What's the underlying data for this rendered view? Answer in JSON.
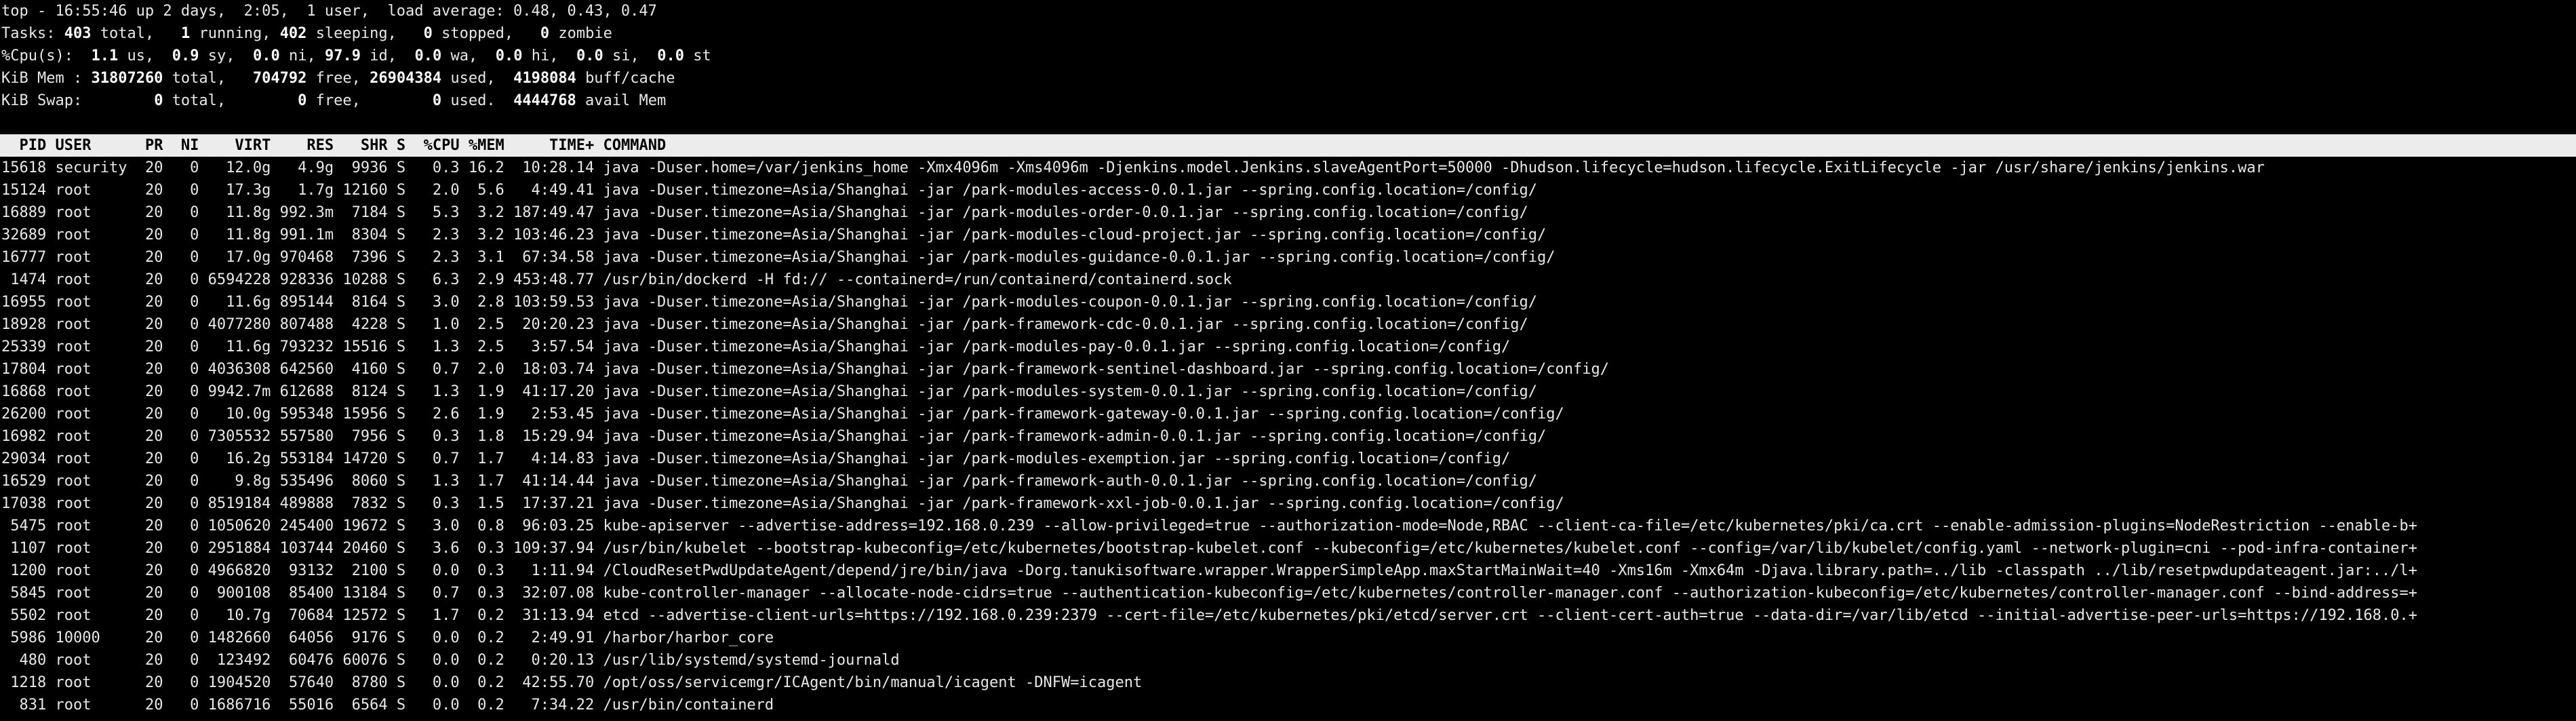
{
  "terminal": {
    "colors": {
      "background": "#000000",
      "foreground": "#e8e8e8",
      "header_bar_background": "#ececec",
      "header_bar_foreground": "#000000"
    },
    "summary": {
      "uptime_line": "top - 16:55:46 up 2 days,  2:05,  1 user,  load average: 0.48, 0.43, 0.47",
      "tasks": {
        "label": "Tasks:",
        "total": "403",
        "total_label": "total,",
        "running": "1",
        "running_label": "running,",
        "sleeping": "402",
        "sleeping_label": "sleeping,",
        "stopped": "0",
        "stopped_label": "stopped,",
        "zombie": "0",
        "zombie_label": "zombie"
      },
      "cpu": {
        "label": "%Cpu(s):",
        "us": "1.1",
        "us_label": "us,",
        "sy": "0.9",
        "sy_label": "sy,",
        "ni": "0.0",
        "ni_label": "ni,",
        "id": "97.9",
        "id_label": "id,",
        "wa": "0.0",
        "wa_label": "wa,",
        "hi": "0.0",
        "hi_label": "hi,",
        "si": "0.0",
        "si_label": "si,",
        "st": "0.0",
        "st_label": "st"
      },
      "mem": {
        "label": "KiB Mem :",
        "total": "31807260",
        "total_label": "total,",
        "free": "704792",
        "free_label": "free,",
        "used": "26904384",
        "used_label": "used,",
        "buff_cache": "4198084",
        "buff_cache_label": "buff/cache"
      },
      "swap": {
        "label": "KiB Swap:",
        "total": "0",
        "total_label": "total,",
        "free": "0",
        "free_label": "free,",
        "used": "0",
        "used_label": "used.",
        "avail": "4444768",
        "avail_label": "avail Mem"
      }
    },
    "columns": [
      "PID",
      "USER",
      "PR",
      "NI",
      "VIRT",
      "RES",
      "SHR",
      "S",
      "%CPU",
      "%MEM",
      "TIME+",
      "COMMAND"
    ],
    "processes": [
      [
        "15618",
        "security",
        "20",
        "0",
        "12.0g",
        "4.9g",
        "9936",
        "S",
        "0.3",
        "16.2",
        "10:28.14",
        "java -Duser.home=/var/jenkins_home -Xmx4096m -Xms4096m -Djenkins.model.Jenkins.slaveAgentPort=50000 -Dhudson.lifecycle=hudson.lifecycle.ExitLifecycle -jar /usr/share/jenkins/jenkins.war"
      ],
      [
        "15124",
        "root",
        "20",
        "0",
        "17.3g",
        "1.7g",
        "12160",
        "S",
        "2.0",
        "5.6",
        "4:49.41",
        "java -Duser.timezone=Asia/Shanghai -jar /park-modules-access-0.0.1.jar --spring.config.location=/config/"
      ],
      [
        "16889",
        "root",
        "20",
        "0",
        "11.8g",
        "992.3m",
        "7184",
        "S",
        "5.3",
        "3.2",
        "187:49.47",
        "java -Duser.timezone=Asia/Shanghai -jar /park-modules-order-0.0.1.jar --spring.config.location=/config/"
      ],
      [
        "32689",
        "root",
        "20",
        "0",
        "11.8g",
        "991.1m",
        "8304",
        "S",
        "2.3",
        "3.2",
        "103:46.23",
        "java -Duser.timezone=Asia/Shanghai -jar /park-modules-cloud-project.jar --spring.config.location=/config/"
      ],
      [
        "16777",
        "root",
        "20",
        "0",
        "17.0g",
        "970468",
        "7396",
        "S",
        "2.3",
        "3.1",
        "67:34.58",
        "java -Duser.timezone=Asia/Shanghai -jar /park-modules-guidance-0.0.1.jar --spring.config.location=/config/"
      ],
      [
        "1474",
        "root",
        "20",
        "0",
        "6594228",
        "928336",
        "10288",
        "S",
        "6.3",
        "2.9",
        "453:48.77",
        "/usr/bin/dockerd -H fd:// --containerd=/run/containerd/containerd.sock"
      ],
      [
        "16955",
        "root",
        "20",
        "0",
        "11.6g",
        "895144",
        "8164",
        "S",
        "3.0",
        "2.8",
        "103:59.53",
        "java -Duser.timezone=Asia/Shanghai -jar /park-modules-coupon-0.0.1.jar --spring.config.location=/config/"
      ],
      [
        "18928",
        "root",
        "20",
        "0",
        "4077280",
        "807488",
        "4228",
        "S",
        "1.0",
        "2.5",
        "20:20.23",
        "java -Duser.timezone=Asia/Shanghai -jar /park-framework-cdc-0.0.1.jar --spring.config.location=/config/"
      ],
      [
        "25339",
        "root",
        "20",
        "0",
        "11.6g",
        "793232",
        "15516",
        "S",
        "1.3",
        "2.5",
        "3:57.54",
        "java -Duser.timezone=Asia/Shanghai -jar /park-modules-pay-0.0.1.jar --spring.config.location=/config/"
      ],
      [
        "17804",
        "root",
        "20",
        "0",
        "4036308",
        "642560",
        "4160",
        "S",
        "0.7",
        "2.0",
        "18:03.74",
        "java -Duser.timezone=Asia/Shanghai -jar /park-framework-sentinel-dashboard.jar --spring.config.location=/config/"
      ],
      [
        "16868",
        "root",
        "20",
        "0",
        "9942.7m",
        "612688",
        "8124",
        "S",
        "1.3",
        "1.9",
        "41:17.20",
        "java -Duser.timezone=Asia/Shanghai -jar /park-modules-system-0.0.1.jar --spring.config.location=/config/"
      ],
      [
        "26200",
        "root",
        "20",
        "0",
        "10.0g",
        "595348",
        "15956",
        "S",
        "2.6",
        "1.9",
        "2:53.45",
        "java -Duser.timezone=Asia/Shanghai -jar /park-framework-gateway-0.0.1.jar --spring.config.location=/config/"
      ],
      [
        "16982",
        "root",
        "20",
        "0",
        "7305532",
        "557580",
        "7956",
        "S",
        "0.3",
        "1.8",
        "15:29.94",
        "java -Duser.timezone=Asia/Shanghai -jar /park-framework-admin-0.0.1.jar --spring.config.location=/config/"
      ],
      [
        "29034",
        "root",
        "20",
        "0",
        "16.2g",
        "553184",
        "14720",
        "S",
        "0.7",
        "1.7",
        "4:14.83",
        "java -Duser.timezone=Asia/Shanghai -jar /park-modules-exemption.jar --spring.config.location=/config/"
      ],
      [
        "16529",
        "root",
        "20",
        "0",
        "9.8g",
        "535496",
        "8060",
        "S",
        "1.3",
        "1.7",
        "41:14.44",
        "java -Duser.timezone=Asia/Shanghai -jar /park-framework-auth-0.0.1.jar --spring.config.location=/config/"
      ],
      [
        "17038",
        "root",
        "20",
        "0",
        "8519184",
        "489888",
        "7832",
        "S",
        "0.3",
        "1.5",
        "17:37.21",
        "java -Duser.timezone=Asia/Shanghai -jar /park-framework-xxl-job-0.0.1.jar --spring.config.location=/config/"
      ],
      [
        "5475",
        "root",
        "20",
        "0",
        "1050620",
        "245400",
        "19672",
        "S",
        "3.0",
        "0.8",
        "96:03.25",
        "kube-apiserver --advertise-address=192.168.0.239 --allow-privileged=true --authorization-mode=Node,RBAC --client-ca-file=/etc/kubernetes/pki/ca.crt --enable-admission-plugins=NodeRestriction --enable-b+"
      ],
      [
        "1107",
        "root",
        "20",
        "0",
        "2951884",
        "103744",
        "20460",
        "S",
        "3.6",
        "0.3",
        "109:37.94",
        "/usr/bin/kubelet --bootstrap-kubeconfig=/etc/kubernetes/bootstrap-kubelet.conf --kubeconfig=/etc/kubernetes/kubelet.conf --config=/var/lib/kubelet/config.yaml --network-plugin=cni --pod-infra-container+"
      ],
      [
        "1200",
        "root",
        "20",
        "0",
        "4966820",
        "93132",
        "2100",
        "S",
        "0.0",
        "0.3",
        "1:11.94",
        "/CloudResetPwdUpdateAgent/depend/jre/bin/java -Dorg.tanukisoftware.wrapper.WrapperSimpleApp.maxStartMainWait=40 -Xms16m -Xmx64m -Djava.library.path=../lib -classpath ../lib/resetpwdupdateagent.jar:../l+"
      ],
      [
        "5845",
        "root",
        "20",
        "0",
        "900108",
        "85400",
        "13184",
        "S",
        "0.7",
        "0.3",
        "32:07.08",
        "kube-controller-manager --allocate-node-cidrs=true --authentication-kubeconfig=/etc/kubernetes/controller-manager.conf --authorization-kubeconfig=/etc/kubernetes/controller-manager.conf --bind-address=+"
      ],
      [
        "5502",
        "root",
        "20",
        "0",
        "10.7g",
        "70684",
        "12572",
        "S",
        "1.7",
        "0.2",
        "31:13.94",
        "etcd --advertise-client-urls=https://192.168.0.239:2379 --cert-file=/etc/kubernetes/pki/etcd/server.crt --client-cert-auth=true --data-dir=/var/lib/etcd --initial-advertise-peer-urls=https://192.168.0.+"
      ],
      [
        "5986",
        "10000",
        "20",
        "0",
        "1482660",
        "64056",
        "9176",
        "S",
        "0.0",
        "0.2",
        "2:49.91",
        "/harbor/harbor_core"
      ],
      [
        "480",
        "root",
        "20",
        "0",
        "123492",
        "60476",
        "60076",
        "S",
        "0.0",
        "0.2",
        "0:20.13",
        "/usr/lib/systemd/systemd-journald"
      ],
      [
        "1218",
        "root",
        "20",
        "0",
        "1904520",
        "57640",
        "8780",
        "S",
        "0.0",
        "0.2",
        "42:55.70",
        "/opt/oss/servicemgr/ICAgent/bin/manual/icagent -DNFW=icagent"
      ],
      [
        "831",
        "root",
        "20",
        "0",
        "1686716",
        "55016",
        "6564",
        "S",
        "0.0",
        "0.2",
        "7:34.22",
        "/usr/bin/containerd"
      ]
    ]
  }
}
